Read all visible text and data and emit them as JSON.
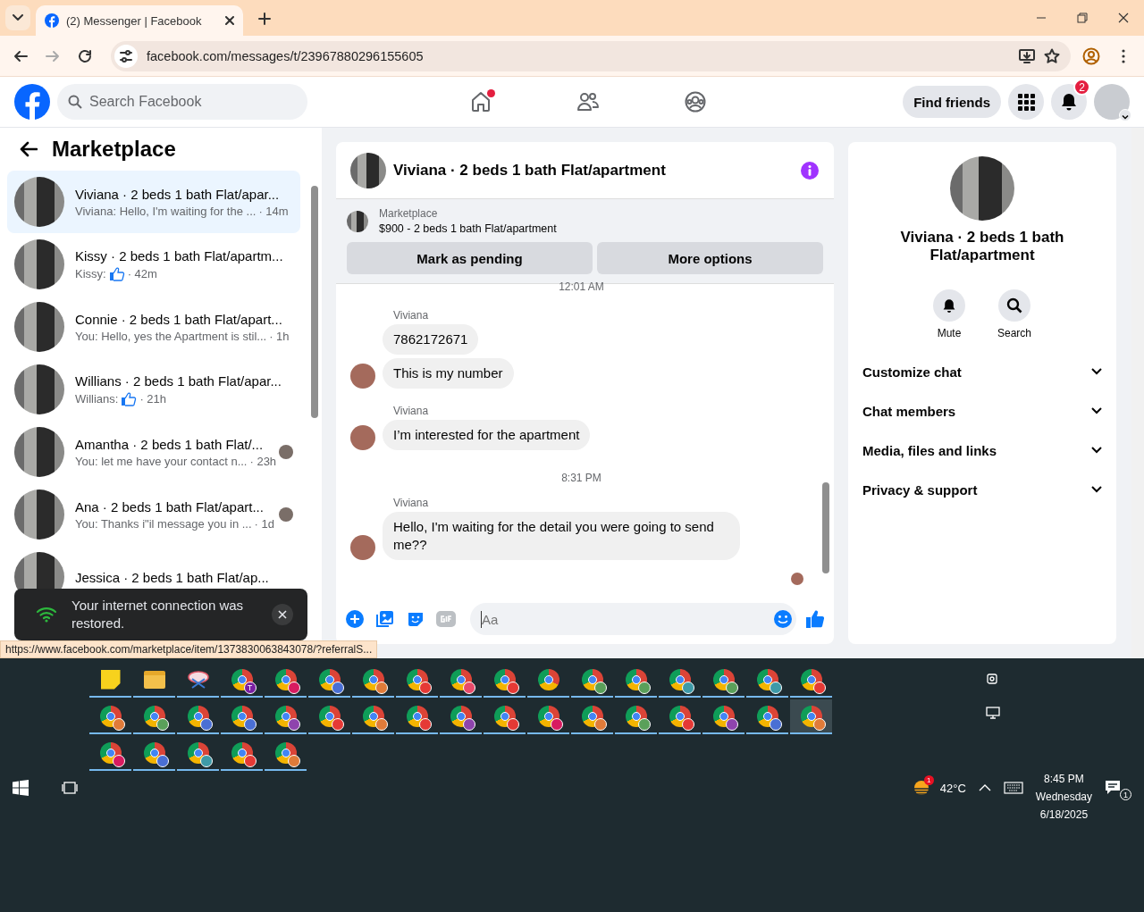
{
  "browser": {
    "tab": {
      "title": "(2) Messenger | Facebook"
    },
    "url": "facebook.com/messages/t/23967880296155605",
    "status_url": "https://www.facebook.com/marketplace/item/1373830063843078/?referralS..."
  },
  "header": {
    "search_placeholder": "Search Facebook",
    "home_dot": true,
    "find_friends": "Find friends",
    "notification_count": "2"
  },
  "sidebar": {
    "title": "Marketplace",
    "conversations": [
      {
        "title": "Viviana · 2 beds 1 bath Flat/apar...",
        "preview": "Viviana: Hello, I'm waiting for the ...",
        "like": false,
        "time": "· 14m",
        "seen": false,
        "selected": true
      },
      {
        "title": "Kissy · 2 beds 1 bath Flat/apartm...",
        "preview": "Kissy:",
        "like": true,
        "time": "· 42m",
        "seen": false,
        "selected": false
      },
      {
        "title": "Connie · 2 beds 1 bath Flat/apart...",
        "preview": "You: Hello, yes the Apartment is stil...",
        "like": false,
        "time": "· 1h",
        "seen": false,
        "selected": false
      },
      {
        "title": "Willians · 2 beds 1 bath Flat/apar...",
        "preview": "Willians:",
        "like": true,
        "time": "· 21h",
        "seen": false,
        "selected": false
      },
      {
        "title": "Amantha · 2 beds 1 bath Flat/...",
        "preview": "You: let me have your contact n...",
        "like": false,
        "time": "· 23h",
        "seen": true,
        "selected": false
      },
      {
        "title": "Ana · 2 beds 1 bath Flat/apart...",
        "preview": "You: Thanks i\"il message you in ...",
        "like": false,
        "time": "· 1d",
        "seen": true,
        "selected": false
      },
      {
        "title": "Jessica · 2 beds 1 bath Flat/ap...",
        "like": false,
        "seen": false,
        "selected": false
      }
    ]
  },
  "chat": {
    "title": "Viviana · 2 beds 1 bath Flat/apartment",
    "listing": {
      "label": "Marketplace",
      "text": "$900 - 2 beds 1 bath Flat/apartment"
    },
    "buttons": [
      "Mark as pending",
      "More options"
    ],
    "messages": [
      {
        "kind": "time",
        "text": "12:01 AM"
      },
      {
        "kind": "group",
        "sender": "Viviana",
        "bubbles": [
          "7862172671",
          "This is my number"
        ]
      },
      {
        "kind": "group",
        "sender": "Viviana",
        "bubbles": [
          "I’m interested for the apartment"
        ]
      },
      {
        "kind": "time",
        "text": "8:31 PM"
      },
      {
        "kind": "group",
        "sender": "Viviana",
        "bubbles": [
          "Hello, I'm waiting for the detail you were going to send me??"
        ]
      }
    ],
    "composer": {
      "placeholder": "Aa"
    }
  },
  "info": {
    "name": "Viviana · 2 beds 1 bath Flat/apartment",
    "actions": [
      {
        "label": "Mute"
      },
      {
        "label": "Search"
      }
    ],
    "sections": [
      {
        "label": "Customize chat",
        "expanded": false
      },
      {
        "label": "Chat members",
        "expanded": false
      },
      {
        "label": "Media, files and links",
        "expanded": false
      },
      {
        "label": "Privacy & support",
        "expanded": false
      }
    ]
  },
  "toast": {
    "text": "Your internet connection was restored."
  },
  "taskbar": {
    "rows": [
      [
        {
          "kind": "sticky-notes",
          "selected": false
        },
        {
          "kind": "folder",
          "selected": false
        },
        {
          "kind": "snipping",
          "selected": false
        },
        {
          "kind": "chrome",
          "color": "#7b1fa2",
          "letter": "T",
          "selected": false
        },
        {
          "kind": "chrome",
          "color": "#d81b60",
          "selected": false
        },
        {
          "kind": "chrome",
          "color": "#4a6fd4",
          "selected": false
        },
        {
          "kind": "chrome",
          "color": "#e07b39",
          "selected": false
        },
        {
          "kind": "chrome",
          "color": "#e53935",
          "selected": false
        },
        {
          "kind": "chrome",
          "color": "#e84a6a",
          "selected": false
        },
        {
          "kind": "chrome",
          "color": "#e53935",
          "selected": false
        },
        {
          "kind": "chrome",
          "selected": false
        },
        {
          "kind": "chrome",
          "color": "#5aa05a",
          "selected": false
        },
        {
          "kind": "chrome",
          "color": "#5aa05a",
          "selected": false
        },
        {
          "kind": "chrome",
          "color": "#3e9aa8",
          "selected": false
        },
        {
          "kind": "chrome",
          "color": "#5aa05a",
          "selected": false
        },
        {
          "kind": "chrome",
          "color": "#3e9aa8",
          "selected": false
        },
        {
          "kind": "chrome",
          "color": "#e53935",
          "selected": false
        }
      ],
      [
        {
          "kind": "chrome",
          "color": "#e07b39",
          "selected": false
        },
        {
          "kind": "chrome",
          "color": "#5aa05a",
          "selected": false
        },
        {
          "kind": "chrome",
          "color": "#4a6fd4",
          "selected": false
        },
        {
          "kind": "chrome",
          "color": "#4a6fd4",
          "selected": false
        },
        {
          "kind": "chrome",
          "color": "#8e44ad",
          "selected": false
        },
        {
          "kind": "chrome",
          "color": "#e53935",
          "selected": false
        },
        {
          "kind": "chrome",
          "color": "#e07b39",
          "selected": false
        },
        {
          "kind": "chrome",
          "color": "#e53935",
          "selected": false
        },
        {
          "kind": "chrome",
          "color": "#8e44ad",
          "selected": false
        },
        {
          "kind": "chrome",
          "color": "#e53935",
          "selected": false
        },
        {
          "kind": "chrome",
          "color": "#d81b60",
          "selected": false
        },
        {
          "kind": "chrome",
          "color": "#e07b39",
          "selected": false
        },
        {
          "kind": "chrome",
          "color": "#5aa05a",
          "selected": false
        },
        {
          "kind": "chrome",
          "color": "#e53935",
          "selected": false
        },
        {
          "kind": "chrome",
          "color": "#8e44ad",
          "selected": false
        },
        {
          "kind": "chrome",
          "color": "#4a6fd4",
          "selected": false
        },
        {
          "kind": "chrome",
          "color": "#e07b39",
          "selected": true
        }
      ],
      [
        {
          "kind": "chrome",
          "color": "#d81b60",
          "selected": false
        },
        {
          "kind": "chrome",
          "color": "#4a6fd4",
          "selected": false
        },
        {
          "kind": "chrome",
          "color": "#3e9aa8",
          "selected": false
        },
        {
          "kind": "chrome",
          "color": "#e53935",
          "selected": false
        },
        {
          "kind": "chrome",
          "color": "#e07b39",
          "selected": false
        }
      ]
    ],
    "weather": {
      "temp": "42°C",
      "badge": "1"
    },
    "time": "8:45 PM",
    "day": "Wednesday",
    "date": "6/18/2025",
    "notifications": "1"
  }
}
